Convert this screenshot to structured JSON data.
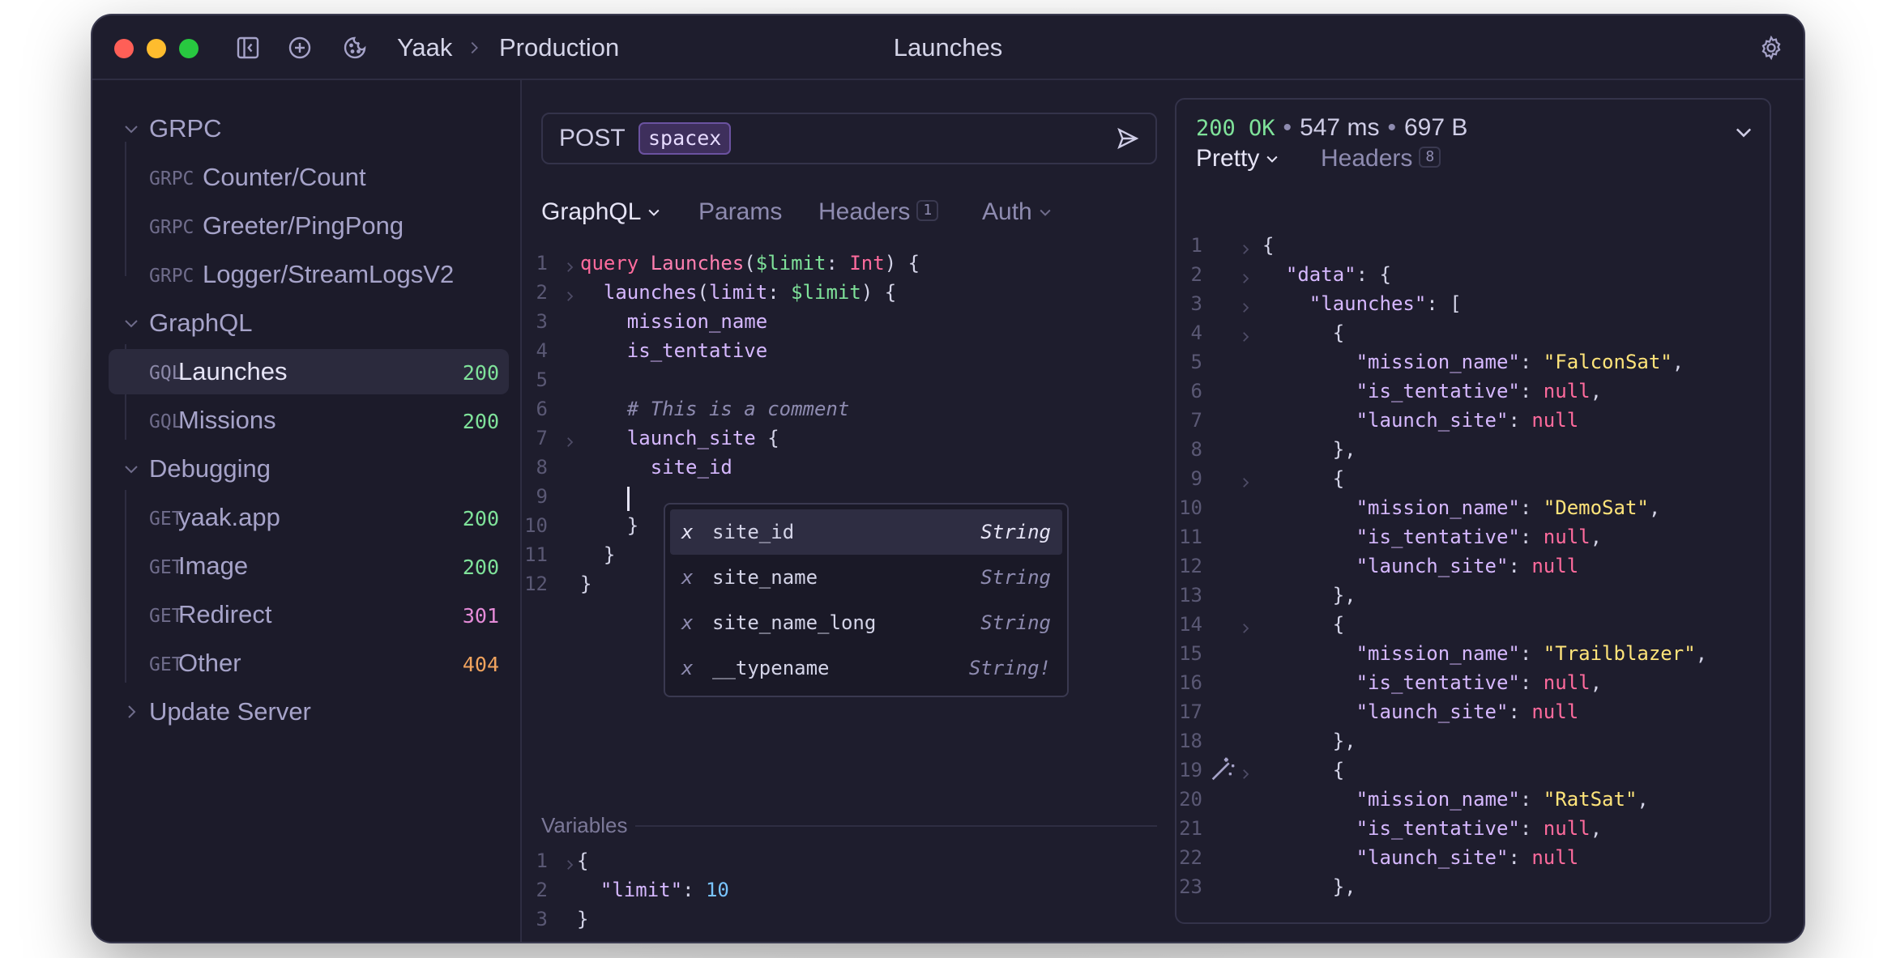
{
  "window": {
    "breadcrumb_workspace": "Yaak",
    "breadcrumb_environment": "Production",
    "title": "Launches"
  },
  "sidebar": {
    "folders": [
      {
        "name": "GRPC",
        "expanded": true
      },
      {
        "name": "GraphQL",
        "expanded": true
      },
      {
        "name": "Debugging",
        "expanded": true
      },
      {
        "name": "Update Server",
        "expanded": false
      }
    ],
    "items": [
      {
        "method": "GRPC",
        "name": "Counter/Count",
        "status": ""
      },
      {
        "method": "GRPC",
        "name": "Greeter/PingPong",
        "status": ""
      },
      {
        "method": "GRPC",
        "name": "Logger/StreamLogsV2",
        "status": ""
      },
      {
        "method": "GQL",
        "name": "Launches",
        "status": "200",
        "selected": true
      },
      {
        "method": "GQL",
        "name": "Missions",
        "status": "200"
      },
      {
        "method": "GET",
        "name": "yaak.app",
        "status": "200"
      },
      {
        "method": "GET",
        "name": "Image",
        "status": "200"
      },
      {
        "method": "GET",
        "name": "Redirect",
        "status": "301"
      },
      {
        "method": "GET",
        "name": "Other",
        "status": "404"
      }
    ],
    "status_colors": {
      "200": "#7fe29a",
      "301": "#e58bd8",
      "404": "#f0a35e"
    }
  },
  "request": {
    "method": "POST",
    "url_variable": "spacex",
    "tabs": [
      {
        "label": "GraphQL",
        "active": true
      },
      {
        "label": "Params"
      },
      {
        "label": "Headers",
        "badge": "1"
      },
      {
        "label": "Auth"
      }
    ],
    "query_lines": [
      "query Launches($limit: Int) {",
      "  launches(limit: $limit) {",
      "    mission_name",
      "    is_tentative",
      "",
      "    # This is a comment",
      "    launch_site {",
      "      site_id",
      "",
      "    }",
      "  }",
      "}"
    ],
    "autocomplete": [
      {
        "kind": "x",
        "label": "site_id",
        "type": "String",
        "selected": true
      },
      {
        "kind": "x",
        "label": "site_name",
        "type": "String"
      },
      {
        "kind": "x",
        "label": "site_name_long",
        "type": "String"
      },
      {
        "kind": "x",
        "label": "__typename",
        "type": "String!"
      }
    ],
    "variables_title": "Variables",
    "variables_lines": [
      "{",
      "  \"limit\": 10",
      "}"
    ]
  },
  "response": {
    "status_code": "200 OK",
    "time": "547 ms",
    "size": "697 B",
    "tabs": [
      {
        "label": "Pretty",
        "active": true
      },
      {
        "label": "Headers",
        "badge": "8"
      }
    ],
    "body_lines": [
      "{",
      "  \"data\": {",
      "    \"launches\": [",
      "      {",
      "        \"mission_name\": \"FalconSat\",",
      "        \"is_tentative\": null,",
      "        \"launch_site\": null",
      "      },",
      "      {",
      "        \"mission_name\": \"DemoSat\",",
      "        \"is_tentative\": null,",
      "        \"launch_site\": null",
      "      },",
      "      {",
      "        \"mission_name\": \"Trailblazer\",",
      "        \"is_tentative\": null,",
      "        \"launch_site\": null",
      "      },",
      "      {",
      "        \"mission_name\": \"RatSat\",",
      "        \"is_tentative\": null,",
      "        \"launch_site\": null",
      "      },"
    ]
  }
}
